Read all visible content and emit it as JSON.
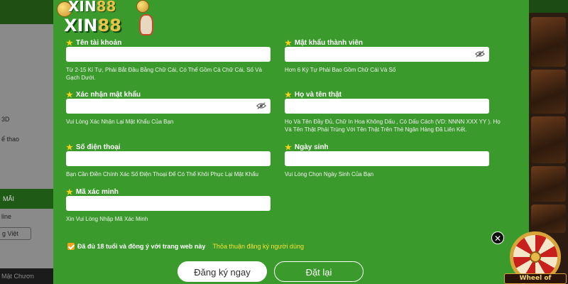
{
  "background": {
    "left_items": [
      "3D",
      "ể thao",
      "MÃI",
      "line",
      "g Việt",
      "Mật Chươn"
    ]
  },
  "logo": {
    "line1_text": "XIN",
    "line1_num": "88",
    "line2_text": "XIN",
    "line2_num": "88"
  },
  "form": {
    "username": {
      "label": "Tên tài khoản",
      "value": "",
      "hint": "Từ 2-15 Kí Tự, Phải Bắt Đầu Bằng Chữ Cái, Có Thể Gồm Cả Chữ Cái, Số Và Gạch Dưới."
    },
    "password": {
      "label": "Mật khẩu thành viên",
      "value": "",
      "hint": "Hơn 6 Ký Tự Phải Bao Gồm Chữ Cái Và Số",
      "icon": "eye-slash-icon"
    },
    "confirm_password": {
      "label": "Xác nhận mật khẩu",
      "value": "",
      "hint": "Vui Lòng Xác Nhận Lại Mật Khẩu Của Bạn",
      "icon": "eye-slash-icon"
    },
    "full_name": {
      "label": "Họ và tên thật",
      "value": "",
      "hint_line1": "Họ Và Tên Đầy Đủ, Chữ In Hoa Không Dấu , Có Dấu Cách (VD: NNNN XXX YY ). Họ",
      "hint_line2": "Và Tên Thật Phải Trùng Với Tên Thật Trên Thẻ Ngân Hàng Đã Liên Kết."
    },
    "phone": {
      "label": "Số điện thoại",
      "value": "",
      "hint": "Bạn Cần Điền Chính Xác Số Điện Thoại Để Có Thể Khôi Phục Lại Mật Khẩu"
    },
    "birthday": {
      "label": "Ngày sinh",
      "value": "",
      "hint": "Vui Lòng Chọn Ngày Sinh Của Bạn"
    },
    "captcha": {
      "label": "Mã xác minh",
      "value": "",
      "hint": "Xin Vui Lòng Nhập Mã Xác Minh"
    },
    "agree": {
      "checked": true,
      "text": "Đã đủ 18 tuổi và đồng ý với trang web này",
      "link": "Thỏa thuận đăng ký người dùng"
    },
    "register_button": "Đăng ký ngay",
    "reset_button": "Đặt lại"
  },
  "wheel_widget": {
    "label": "Wheel of Fortune",
    "close": "✕"
  },
  "colors": {
    "modal_bg": "#3a9a2b",
    "star": "#f5d21a",
    "link": "#f6e23a",
    "checkbox": "#f0a21a"
  }
}
